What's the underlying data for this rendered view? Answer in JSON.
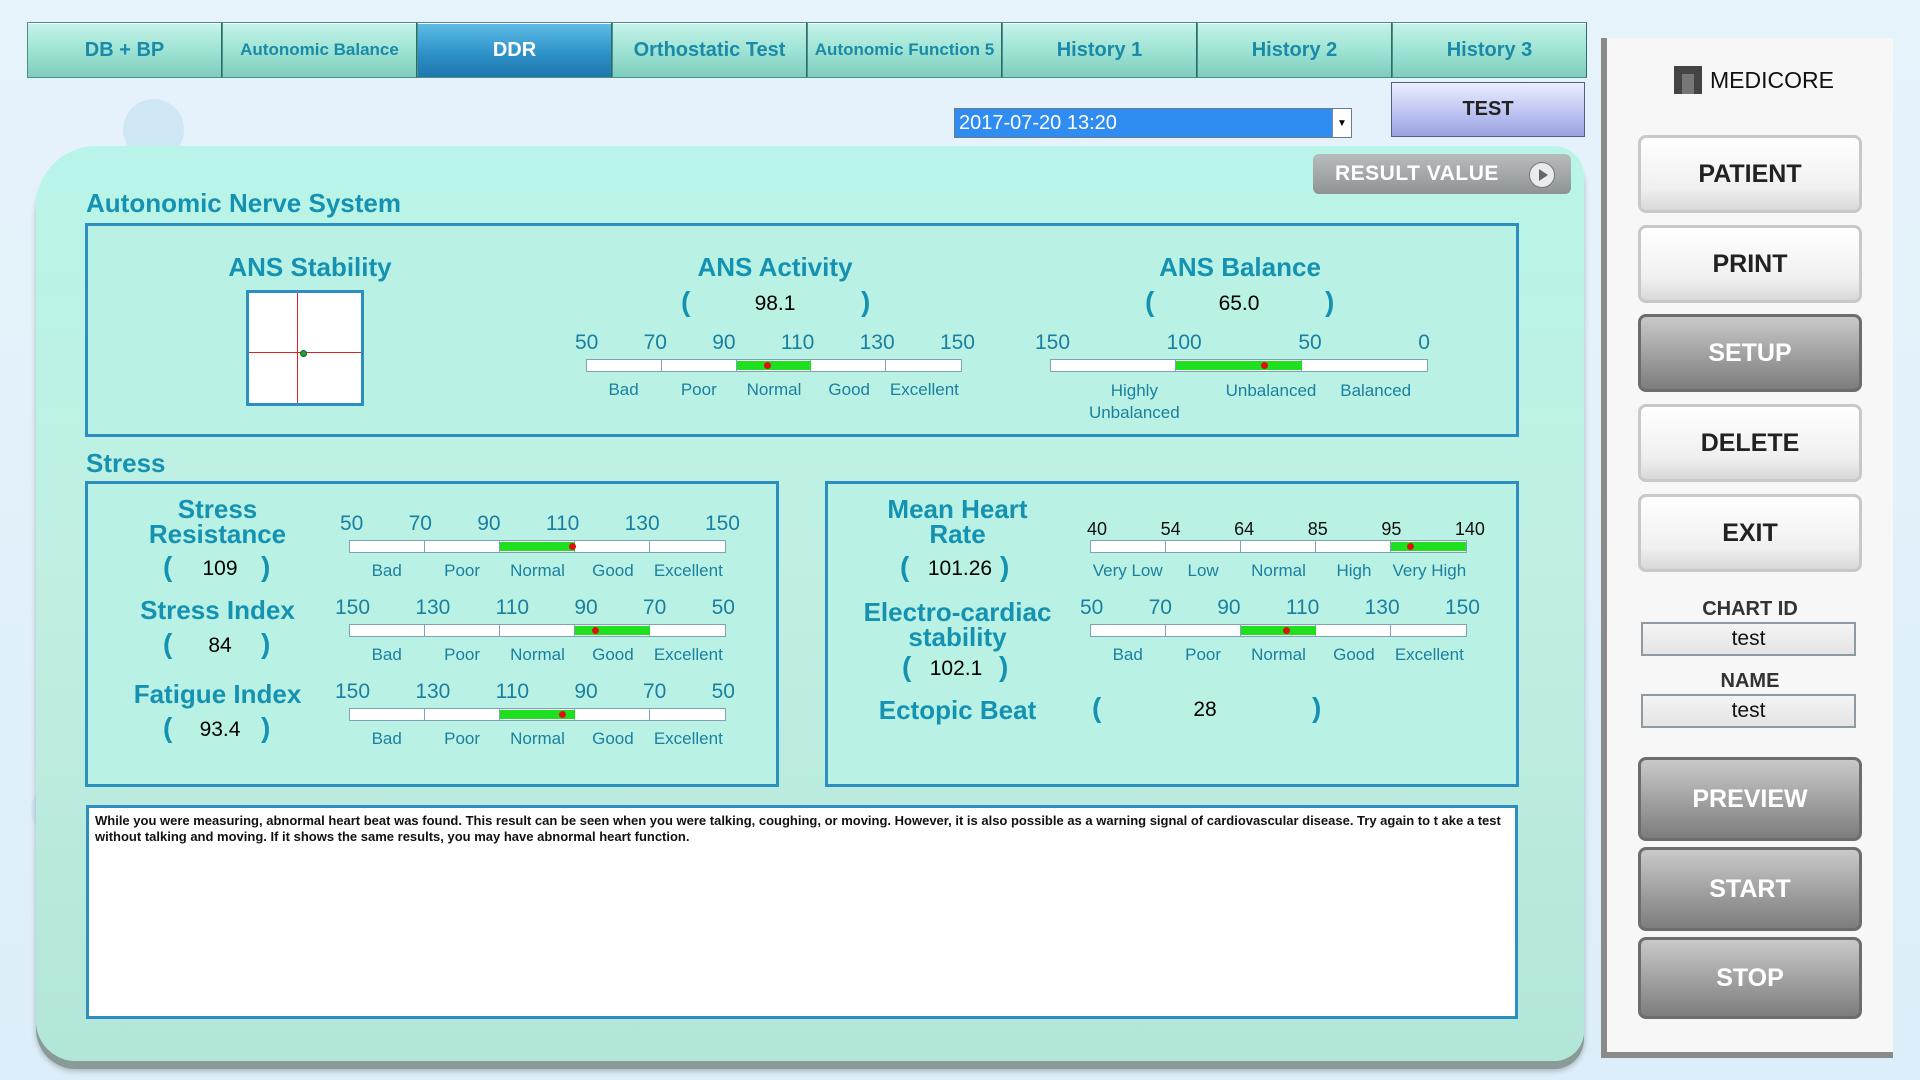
{
  "tabs": [
    "DB + BP",
    "Autonomic Balance",
    "DDR",
    "Orthostatic Test",
    "Autonomic Function 5",
    "History 1",
    "History 2",
    "History 3"
  ],
  "test_button": "TEST",
  "date_select": {
    "value": "2017-07-20 13:20"
  },
  "result_value_button": "RESULT VALUE",
  "ans": {
    "title": "Autonomic Nerve System",
    "stability": {
      "title": "ANS Stability"
    },
    "activity": {
      "title": "ANS Activity",
      "value": "98.1",
      "ticks": [
        "50",
        "70",
        "90",
        "110",
        "130",
        "150"
      ],
      "labels": [
        "Bad",
        "Poor",
        "Normal",
        "Good",
        "Excellent"
      ],
      "fill_from": 0.4,
      "fill_to": 0.6,
      "marker": 0.48
    },
    "balance": {
      "title": "ANS Balance",
      "value": "65.0",
      "ticks": [
        "150",
        "100",
        "50",
        "0"
      ],
      "labels": [
        "Highly Unbalanced",
        "Unbalanced",
        "Balanced"
      ],
      "fill_from": 0.333,
      "fill_to": 0.667,
      "marker": 0.567
    }
  },
  "stress": {
    "title": "Stress",
    "resistance": {
      "title": "Stress Resistance",
      "value": "109",
      "ticks": [
        "50",
        "70",
        "90",
        "110",
        "130",
        "150"
      ],
      "labels": [
        "Bad",
        "Poor",
        "Normal",
        "Good",
        "Excellent"
      ],
      "fill_from": 0.4,
      "fill_to": 0.6,
      "marker": 0.592
    },
    "index": {
      "title": "Stress Index",
      "value": "84",
      "ticks": [
        "150",
        "130",
        "110",
        "90",
        "70",
        "50"
      ],
      "labels": [
        "Bad",
        "Poor",
        "Normal",
        "Good",
        "Excellent"
      ],
      "fill_from": 0.6,
      "fill_to": 0.8,
      "marker": 0.652
    },
    "fatigue": {
      "title": "Fatigue Index",
      "value": "93.4",
      "ticks": [
        "150",
        "130",
        "110",
        "90",
        "70",
        "50"
      ],
      "labels": [
        "Bad",
        "Poor",
        "Normal",
        "Good",
        "Excellent"
      ],
      "fill_from": 0.4,
      "fill_to": 0.6,
      "marker": 0.566
    },
    "mean_hr": {
      "title": "Mean Heart Rate",
      "value": "101.26",
      "ticks": [
        "40",
        "54",
        "64",
        "85",
        "95",
        "140"
      ],
      "labels": [
        "Very Low",
        "Low",
        "Normal",
        "High",
        "Very High"
      ],
      "fill_from": 0.8,
      "fill_to": 1.0,
      "marker": 0.851
    },
    "ecs": {
      "title": "Electro-cardiac stability",
      "value": "102.1",
      "ticks": [
        "50",
        "70",
        "90",
        "110",
        "130",
        "150"
      ],
      "labels": [
        "Bad",
        "Poor",
        "Normal",
        "Good",
        "Excellent"
      ],
      "fill_from": 0.4,
      "fill_to": 0.6,
      "marker": 0.521
    },
    "ectopic": {
      "title": "Ectopic Beat",
      "value": "28"
    }
  },
  "message": "While you were measuring, abnormal heart beat was found. This result can be seen when you were talking, coughing, or moving. However, it is also possible as a warning signal of cardiovascular disease. Try again to t ake a test without talking and moving. If it shows the same results, you may have abnormal heart function.",
  "sidebar": {
    "logo": "MEDICORE",
    "buttons": [
      "PATIENT",
      "PRINT",
      "SETUP",
      "DELETE",
      "EXIT"
    ],
    "chart_id_label": "CHART ID",
    "chart_id": "test",
    "name_label": "NAME",
    "name": "test",
    "preview": "PREVIEW",
    "start": "START",
    "stop": "STOP"
  }
}
